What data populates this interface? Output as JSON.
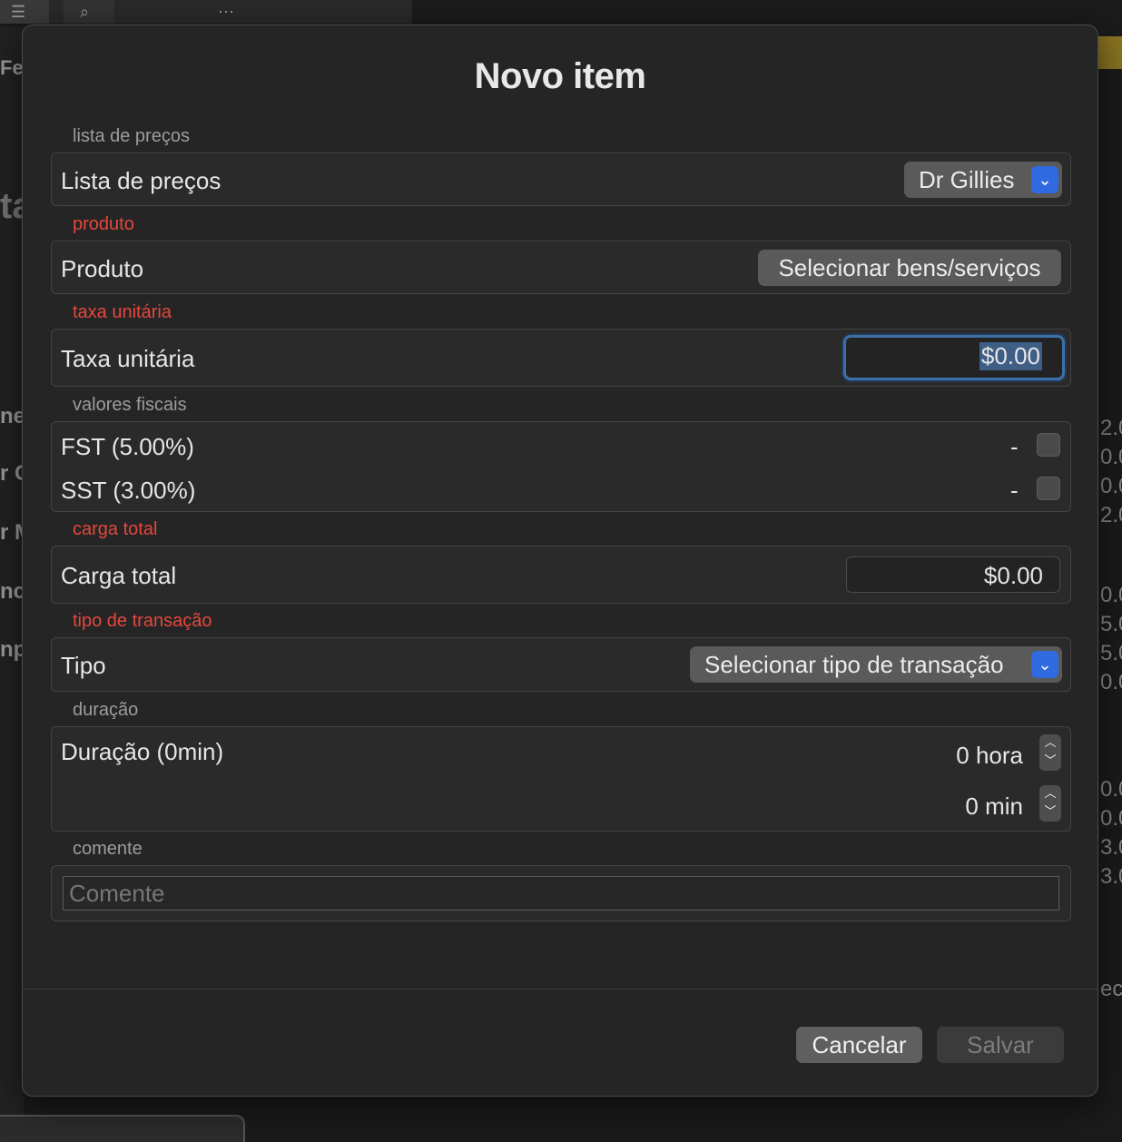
{
  "background": {
    "fragments": [
      "Fe",
      "ta",
      "ne",
      "r C",
      "r M",
      "nc",
      "np"
    ],
    "right_numbers": [
      "2.0",
      "0.0",
      "0.0",
      "2.0",
      "0.0",
      "5.0",
      "5.0",
      "0.0",
      "0.0",
      "0.0",
      "3.0",
      "3.0"
    ],
    "right_text": "ech"
  },
  "dialog": {
    "title": "Novo item",
    "price_list": {
      "section": "lista de preços",
      "label": "Lista de preços",
      "value": "Dr Gillies"
    },
    "product": {
      "section": "produto",
      "label": "Produto",
      "button": "Selecionar bens/serviços"
    },
    "unit_rate": {
      "section": "taxa unitária",
      "label": "Taxa unitária",
      "value": "$0.00"
    },
    "tax": {
      "section": "valores fiscais",
      "items": [
        {
          "label": "FST (5.00%)",
          "value": "-"
        },
        {
          "label": "SST (3.00%)",
          "value": "-"
        }
      ]
    },
    "total": {
      "section": "carga total",
      "label": "Carga total",
      "value": "$0.00"
    },
    "type": {
      "section": "tipo de transação",
      "label": "Tipo",
      "value": "Selecionar tipo de transação"
    },
    "duration": {
      "section": "duração",
      "label": "Duração (0min)",
      "hours": "0 hora",
      "minutes": "0 min"
    },
    "comment": {
      "section": "comente",
      "placeholder": "Comente"
    },
    "buttons": {
      "cancel": "Cancelar",
      "save": "Salvar"
    }
  }
}
